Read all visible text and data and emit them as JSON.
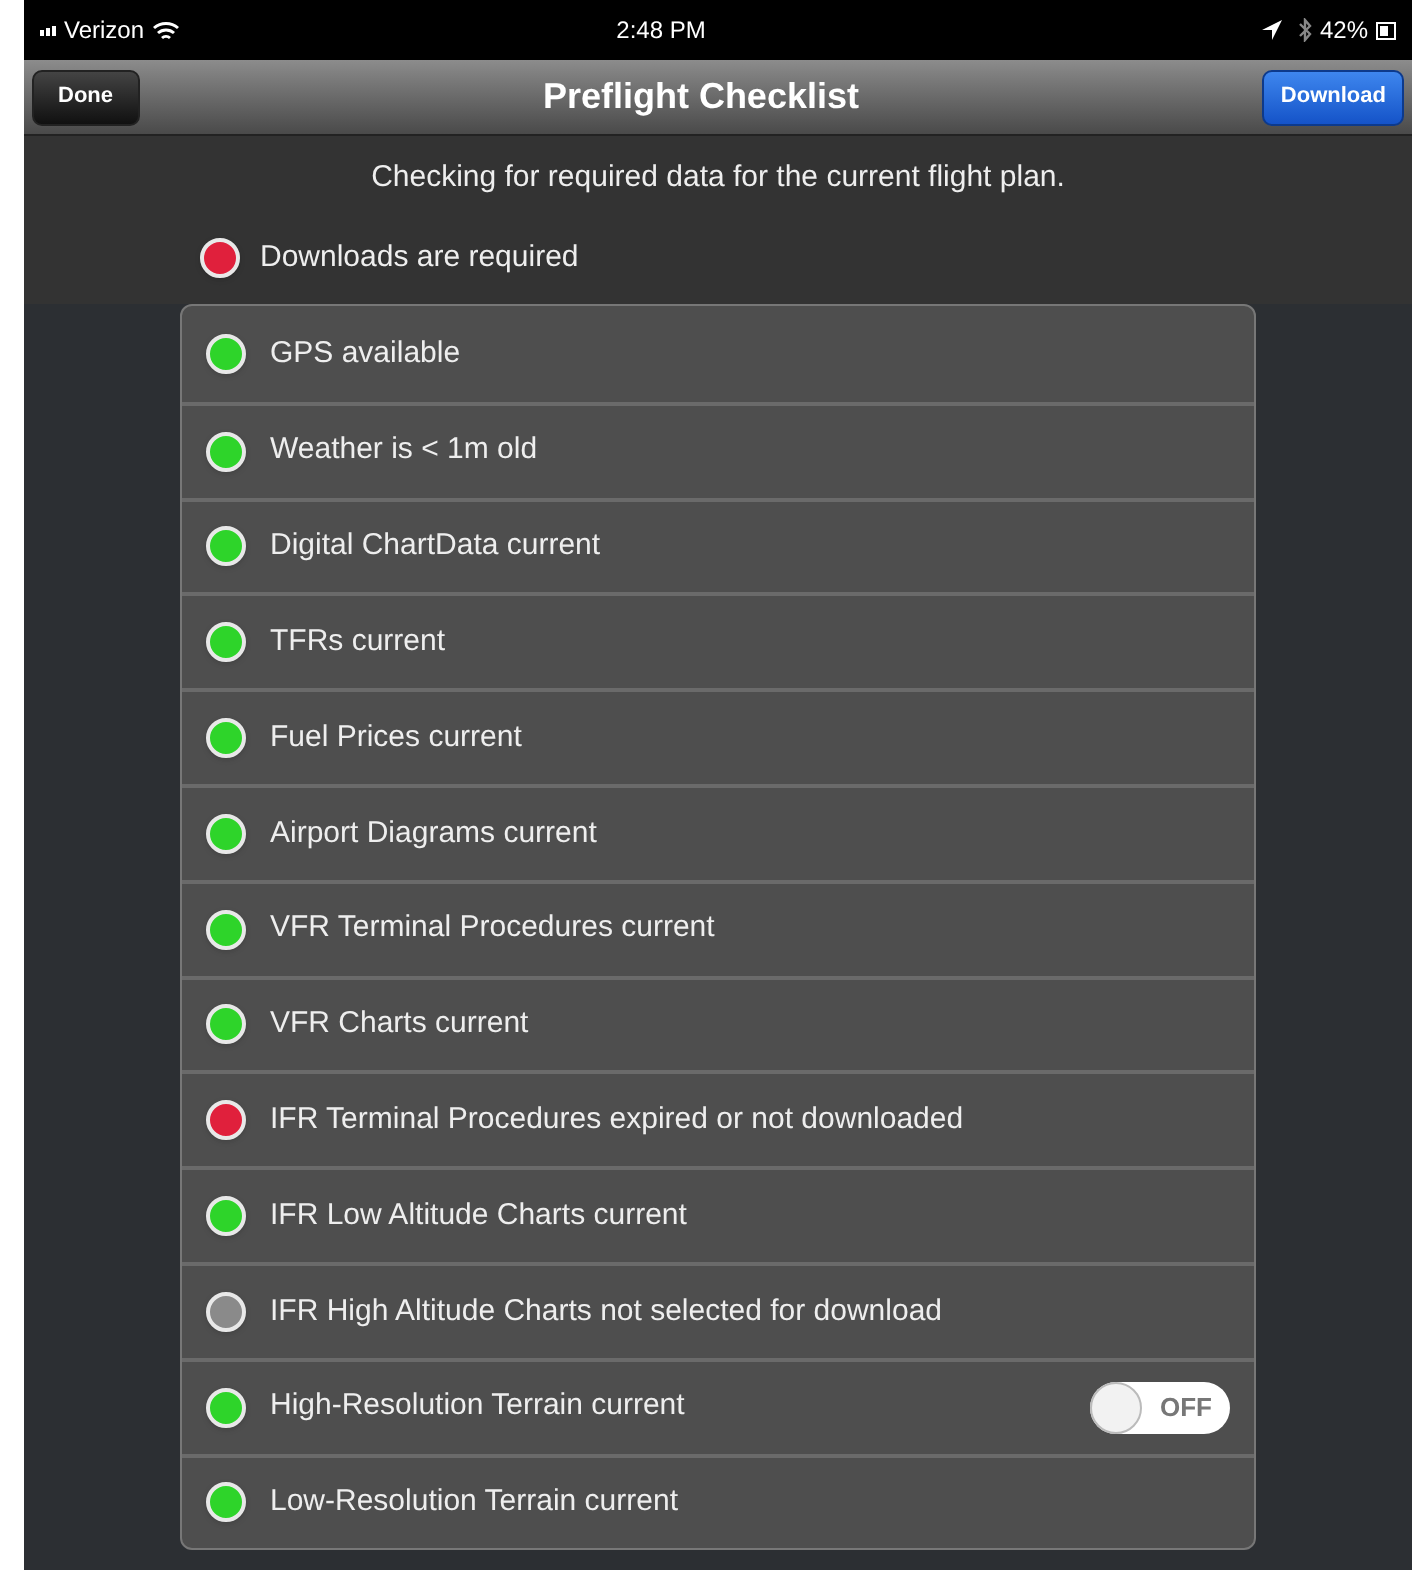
{
  "status_bar": {
    "carrier": "Verizon",
    "time": "2:48 PM",
    "battery": "42%"
  },
  "nav_bar": {
    "left_button": "Done",
    "title": "Preflight Checklist",
    "right_button": "Download"
  },
  "subtitle": "Checking for required data for the current flight plan.",
  "summary": {
    "label": "Downloads are required",
    "color": "#e0203c"
  },
  "items": [
    {
      "label": "GPS available",
      "color": "#2ed42a"
    },
    {
      "label": "Weather is < 1m old",
      "color": "#2ed42a"
    },
    {
      "label": "Digital ChartData current",
      "color": "#2ed42a"
    },
    {
      "label": "TFRs current",
      "color": "#2ed42a"
    },
    {
      "label": "Fuel Prices current",
      "color": "#2ed42a"
    },
    {
      "label": "Airport Diagrams current",
      "color": "#2ed42a"
    },
    {
      "label": "VFR Terminal Procedures current",
      "color": "#2ed42a"
    },
    {
      "label": "VFR Charts current",
      "color": "#2ed42a"
    },
    {
      "label": "IFR Terminal Procedures expired or not downloaded",
      "color": "#e0203c"
    },
    {
      "label": "IFR Low Altitude Charts current",
      "color": "#2ed42a"
    },
    {
      "label": "IFR High Altitude Charts not selected for download",
      "color": "#8a8a8a"
    },
    {
      "label": "High-Resolution Terrain current",
      "color": "#2ed42a",
      "kind": "toggle",
      "toggle": {
        "on": false,
        "text": "OFF"
      }
    },
    {
      "label": "Low-Resolution Terrain current",
      "color": "#2ed42a"
    }
  ]
}
